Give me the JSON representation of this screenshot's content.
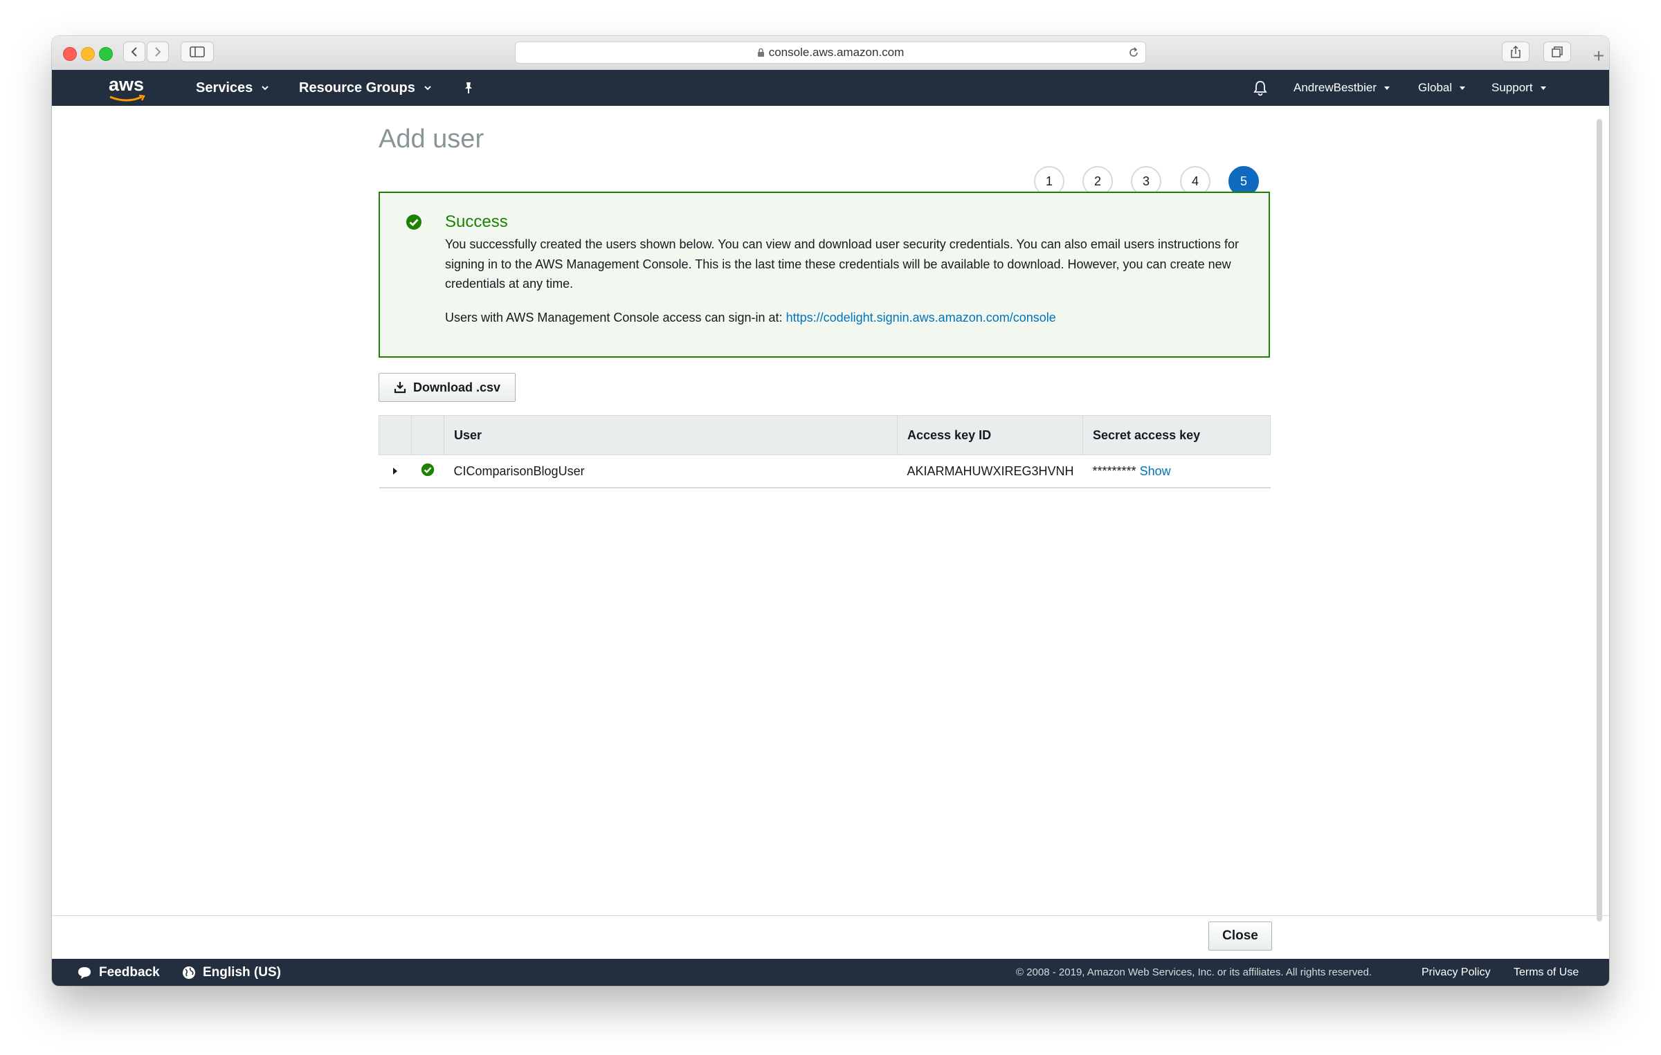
{
  "browser": {
    "url": "console.aws.amazon.com"
  },
  "navbar": {
    "logo_text": "aws",
    "services_label": "Services",
    "resource_groups_label": "Resource Groups",
    "account_label": "AndrewBestbier",
    "region_label": "Global",
    "support_label": "Support"
  },
  "page": {
    "title": "Add user",
    "steps": [
      "1",
      "2",
      "3",
      "4",
      "5"
    ],
    "active_step": "5"
  },
  "alert": {
    "title": "Success",
    "body": "You successfully created the users shown below. You can view and download user security credentials. You can also email users instructions for signing in to the AWS Management Console. This is the last time these credentials will be available to download. However, you can create new credentials at any time.",
    "signin_prefix": "Users with AWS Management Console access can sign-in at: ",
    "signin_url": "https://codelight.signin.aws.amazon.com/console"
  },
  "download_label": "Download .csv",
  "table": {
    "headers": {
      "user": "User",
      "access_key": "Access key ID",
      "secret_key": "Secret access key"
    },
    "rows": [
      {
        "user": "CIComparisonBlogUser",
        "access_key": "AKIARMAHUWXIREG3HVNH",
        "secret_masked": "*********",
        "secret_action": "Show"
      }
    ]
  },
  "close_label": "Close",
  "footer": {
    "feedback_label": "Feedback",
    "language_label": "English (US)",
    "copyright": "© 2008 - 2019, Amazon Web Services, Inc. or its affiliates. All rights reserved.",
    "privacy_label": "Privacy Policy",
    "terms_label": "Terms of Use"
  },
  "colors": {
    "navbar": "#232f3e",
    "success": "#1d8102",
    "link": "#0073bb",
    "active_step": "#0f6abf"
  }
}
